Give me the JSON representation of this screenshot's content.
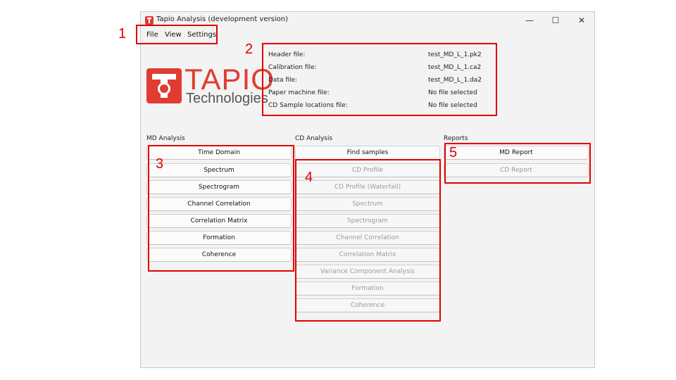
{
  "window": {
    "title": "Tapio Analysis (development version)",
    "controls": {
      "minimize": "—",
      "maximize": "☐",
      "close": "✕"
    }
  },
  "menu": [
    "File",
    "View",
    "Settings"
  ],
  "logo": {
    "word": "TAPIO",
    "sub": "Technologies"
  },
  "files": [
    {
      "label": "Header file:",
      "value": "test_MD_L_1.pk2"
    },
    {
      "label": "Calibration file:",
      "value": "test_MD_L_1.ca2"
    },
    {
      "label": "Data file:",
      "value": "test_MD_L_1.da2"
    },
    {
      "label": "Paper machine file:",
      "value": "No file selected"
    },
    {
      "label": "CD Sample locations file:",
      "value": "No file selected"
    }
  ],
  "md_analysis": {
    "title": "MD Analysis",
    "buttons": [
      "Time Domain",
      "Spectrum",
      "Spectrogram",
      "Channel Correlation",
      "Correlation Matrix",
      "Formation",
      "Coherence"
    ]
  },
  "cd_analysis": {
    "title": "CD Analysis",
    "find_samples": "Find samples",
    "buttons": [
      "CD Profile",
      "CD Profile (Waterfall)",
      "Spectrum",
      "Spectrogram",
      "Channel Correlation",
      "Correlation Matrix",
      "Variance Component Analysis",
      "Formation",
      "Coherence"
    ]
  },
  "reports": {
    "title": "Reports",
    "md_report": "MD Report",
    "cd_report": "CD Report"
  },
  "annotations": [
    "1",
    "2",
    "3",
    "4",
    "5"
  ],
  "colors": {
    "brand": "#e03c31",
    "annotation": "#e00000"
  }
}
